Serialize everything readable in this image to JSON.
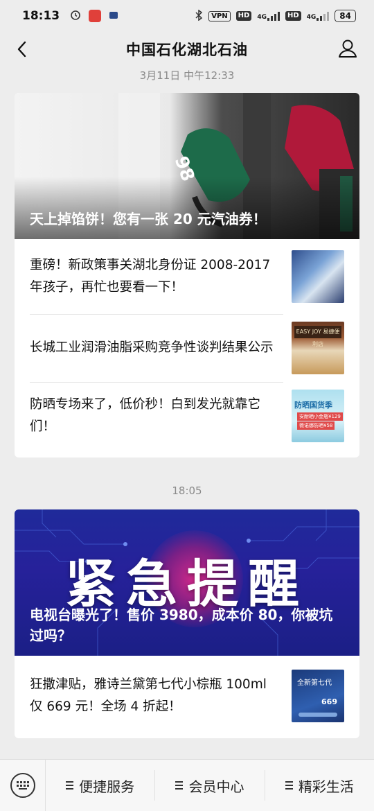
{
  "status_bar": {
    "time": "18:13",
    "vpn": "VPN",
    "hd1": "HD",
    "net1": "4G",
    "hd2": "HD",
    "net2": "4G",
    "battery": "84"
  },
  "header": {
    "title": "中国石化湖北石油"
  },
  "messages": [
    {
      "timestamp": "3月11日 中午12:33",
      "hero_caption": "天上掉馅饼！您有一张 20 元汽油券！",
      "items": [
        {
          "title": "重磅！新政策事关湖北身份证 2008-2017 年孩子，再忙也要看一下！"
        },
        {
          "title": "长城工业润滑油脂采购竞争性谈判结果公示",
          "thumb_text": "EASY JOY 易捷便利店"
        },
        {
          "title": "防晒专场来了，低价秒！白到发光就靠它们！",
          "thumb_text": "防晒国货季",
          "thumb_tag1": "安耐晒小金瓶¥129",
          "thumb_tag2": "薇诺娜防晒¥58"
        }
      ]
    },
    {
      "timestamp": "18:05",
      "banner_text": "紧急提醒",
      "hero_caption": "电视台曝光了！售价 3980，成本价 80，你被坑过吗？",
      "items": [
        {
          "title": "狂撒津贴，雅诗兰黛第七代小棕瓶 100ml 仅 669 元！全场 4 折起！",
          "thumb_text": "全新第七代",
          "thumb_price": "669"
        }
      ]
    }
  ],
  "bottom_menu": {
    "items": [
      "便捷服务",
      "会员中心",
      "精彩生活"
    ]
  },
  "colors": {
    "background": "#ededed",
    "card": "#ffffff",
    "timestamp": "#8a8a8a",
    "banner_blue": "#26219a"
  }
}
